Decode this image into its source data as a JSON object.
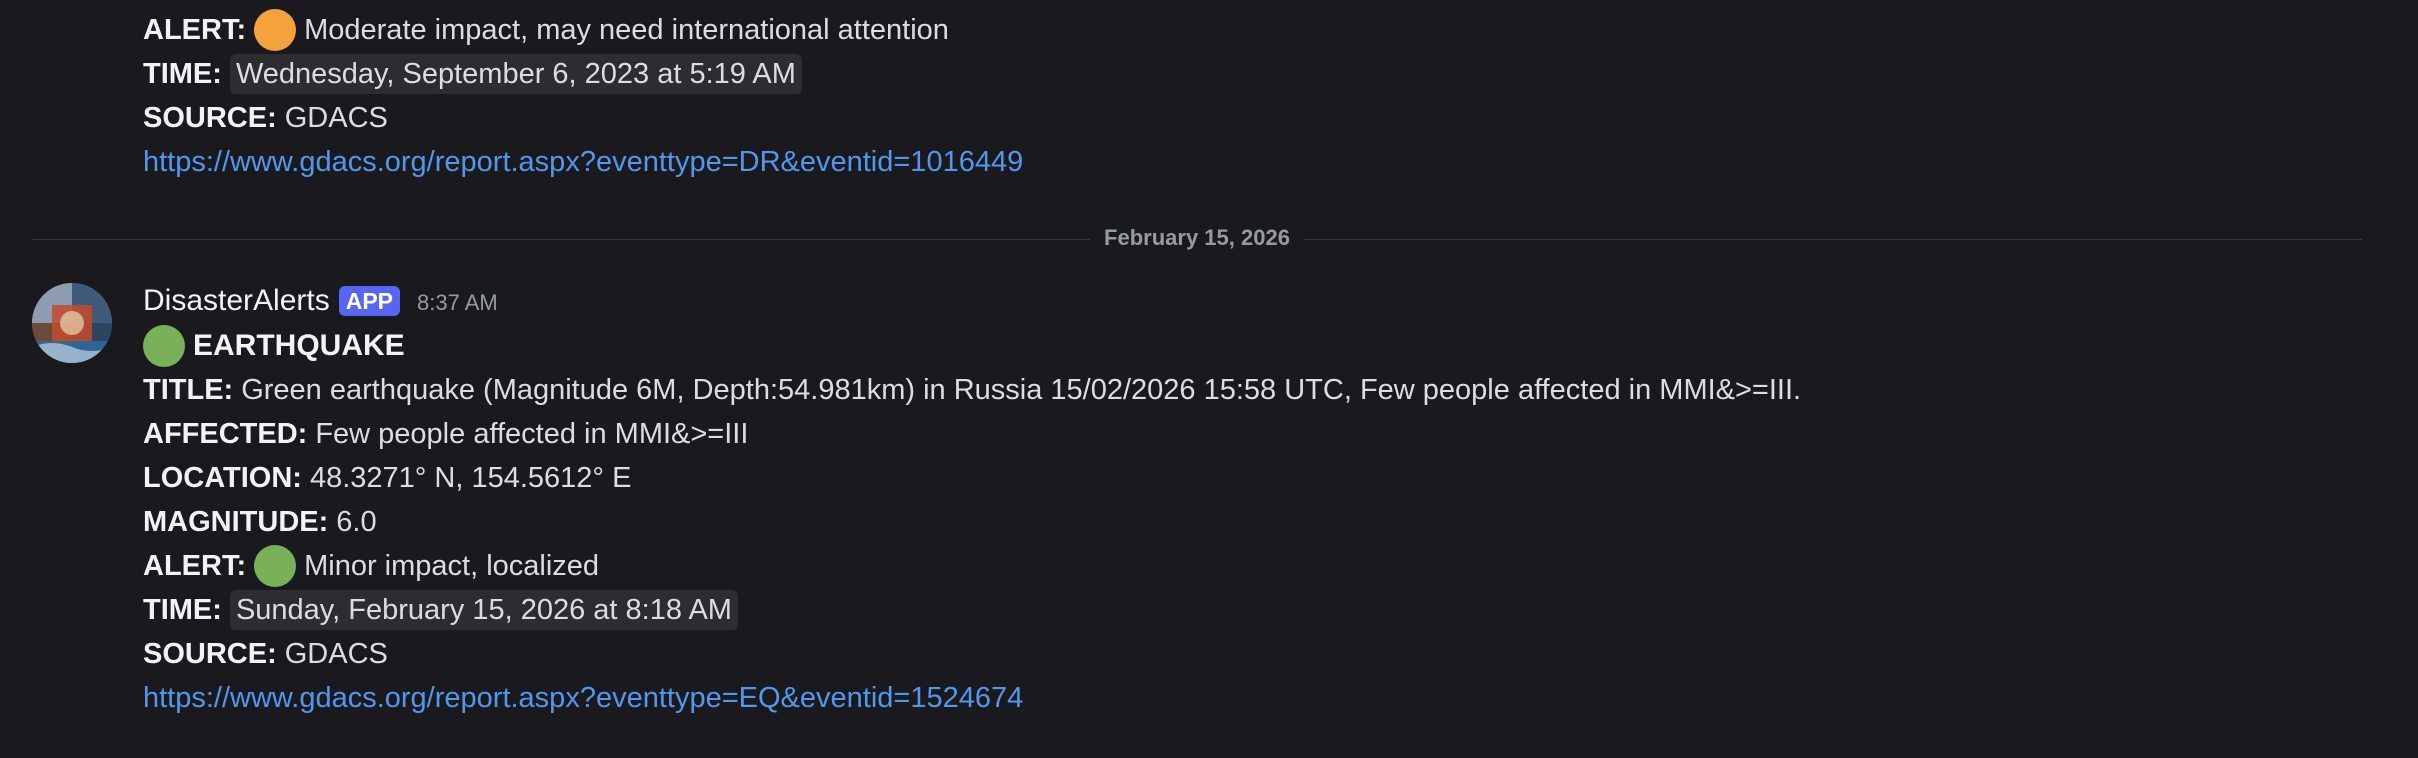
{
  "previous_message": {
    "alert_label": "ALERT:",
    "alert_color": "#f4a23c",
    "alert_text": "Moderate impact, may need international attention",
    "time_label": "TIME:",
    "time_value": "Wednesday, September 6, 2023 at 5:19 AM",
    "source_label": "SOURCE:",
    "source_value": "GDACS",
    "link": "https://www.gdacs.org/report.aspx?eventtype=DR&eventid=1016449"
  },
  "date_divider": "February 15, 2026",
  "message": {
    "username": "DisasterAlerts",
    "badge": "APP",
    "time": "8:37 AM",
    "event_type": "EARTHQUAKE",
    "event_icon_color": "#78b159",
    "title_label": "TITLE:",
    "title_value": "Green earthquake (Magnitude 6M, Depth:54.981km) in Russia 15/02/2026 15:58 UTC, Few people affected in MMI&>=III.",
    "affected_label": "AFFECTED:",
    "affected_value": "Few people affected in MMI&>=III",
    "location_label": "LOCATION:",
    "location_value": "48.3271° N, 154.5612° E",
    "magnitude_label": "MAGNITUDE:",
    "magnitude_value": "6.0",
    "alert_label": "ALERT:",
    "alert_color": "#78b159",
    "alert_text": "Minor impact, localized",
    "time_label": "TIME:",
    "time_value": "Sunday, February 15, 2026 at 8:18 AM",
    "source_label": "SOURCE:",
    "source_value": "GDACS",
    "link": "https://www.gdacs.org/report.aspx?eventtype=EQ&eventid=1524674"
  }
}
